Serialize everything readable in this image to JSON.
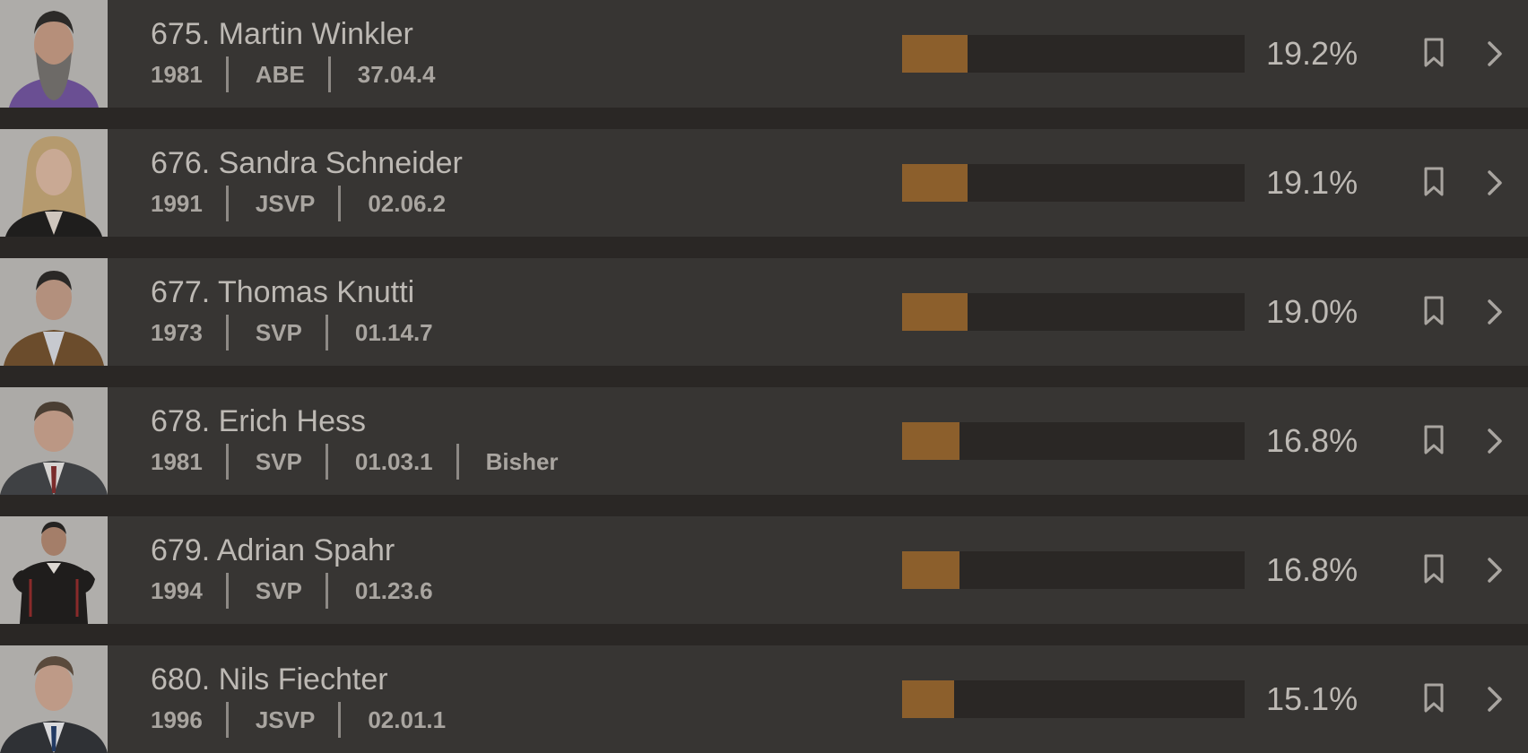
{
  "candidates": [
    {
      "name": "675. Martin Winkler",
      "year": "1981",
      "party": "ABE",
      "list_code": "37.04.4",
      "status": "",
      "percent_label": "19.2%",
      "percent": 19.2
    },
    {
      "name": "676. Sandra Schneider",
      "year": "1991",
      "party": "JSVP",
      "list_code": "02.06.2",
      "status": "",
      "percent_label": "19.1%",
      "percent": 19.1
    },
    {
      "name": "677. Thomas Knutti",
      "year": "1973",
      "party": "SVP",
      "list_code": "01.14.7",
      "status": "",
      "percent_label": "19.0%",
      "percent": 19.0
    },
    {
      "name": "678. Erich Hess",
      "year": "1981",
      "party": "SVP",
      "list_code": "01.03.1",
      "status": "Bisher",
      "percent_label": "16.8%",
      "percent": 16.8
    },
    {
      "name": "679. Adrian Spahr",
      "year": "1994",
      "party": "SVP",
      "list_code": "01.23.6",
      "status": "",
      "percent_label": "16.8%",
      "percent": 16.8
    },
    {
      "name": "680. Nils Fiechter",
      "year": "1996",
      "party": "JSVP",
      "list_code": "02.01.1",
      "status": "",
      "percent_label": "15.1%",
      "percent": 15.1
    }
  ],
  "colors": {
    "bar_fill": "#8c5f2c",
    "bar_track": "#2a2725",
    "row_bg": "#373533"
  },
  "icons": {
    "bookmark": "bookmark-icon",
    "chevron": "chevron-right-icon"
  }
}
